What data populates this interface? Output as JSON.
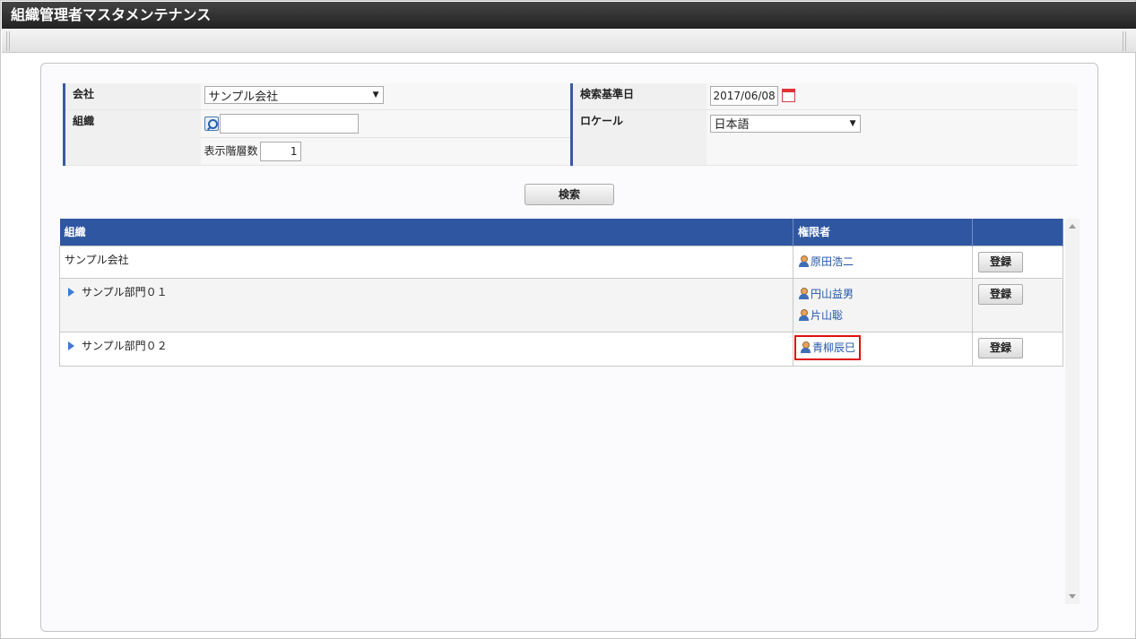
{
  "window": {
    "title": "組織管理者マスタメンテナンス"
  },
  "search": {
    "company_label": "会社",
    "company_value": "サンプル会社",
    "org_label": "組織",
    "org_value": "",
    "depth_label": "表示階層数",
    "depth_value": "1",
    "date_label": "検索基準日",
    "date_value": "2017/06/08",
    "locale_label": "ロケール",
    "locale_value": "日本語",
    "search_button": "検索"
  },
  "grid": {
    "columns": [
      "組織",
      "権限者",
      ""
    ],
    "register_label": "登録",
    "rows": [
      {
        "org": "サンプル会社",
        "users": [
          "原田浩二"
        ]
      },
      {
        "org": "サンプル部門０１",
        "users": [
          "円山益男",
          "片山聡"
        ]
      },
      {
        "org": "サンプル部門０２",
        "users": [
          "青柳辰巳"
        ]
      }
    ]
  },
  "colors": {
    "header": "#2f56a0",
    "highlight": "#e01010",
    "link": "#2255aa"
  }
}
